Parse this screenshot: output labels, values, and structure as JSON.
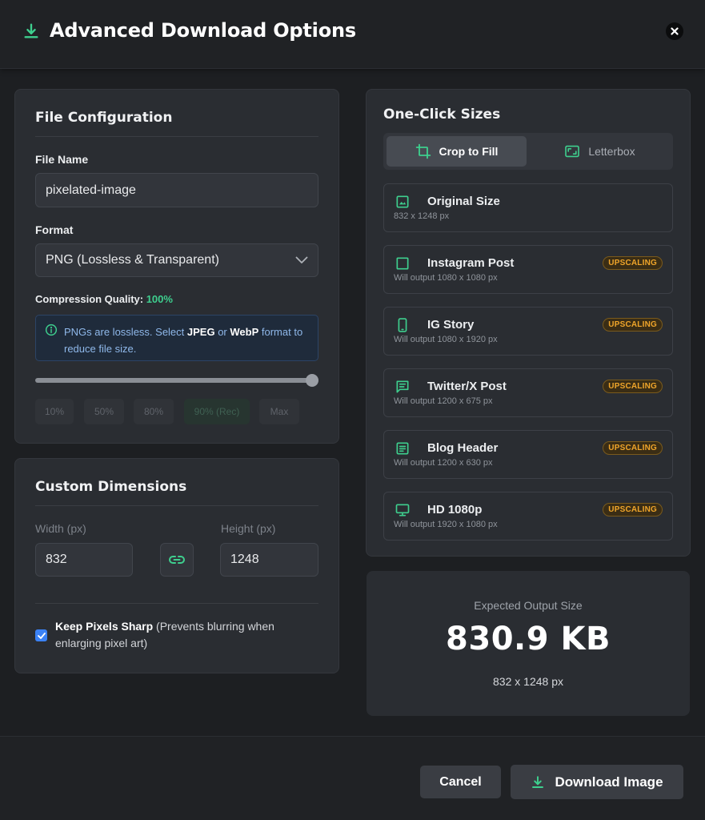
{
  "header": {
    "title": "Advanced Download Options"
  },
  "file_config": {
    "title": "File Configuration",
    "file_name_label": "File Name",
    "file_name_value": "pixelated-image",
    "format_label": "Format",
    "format_value": "PNG (Lossless & Transparent)",
    "quality_label": "Compression Quality:",
    "quality_value": "100%",
    "quality_level": 1.0,
    "info": {
      "pre": "PNGs are lossless. Select ",
      "jpeg": "JPEG",
      "mid": " or ",
      "webp": "WebP",
      "post": " format to reduce file size."
    },
    "presets": [
      "10%",
      "50%",
      "80%",
      "90% (Rec)",
      "Max"
    ]
  },
  "custom_dims": {
    "title": "Custom Dimensions",
    "width_label": "Width (px)",
    "width_value": "832",
    "height_label": "Height (px)",
    "height_value": "1248",
    "keep_sharp_bold": "Keep Pixels Sharp",
    "keep_sharp_rest": " (Prevents blurring when enlarging pixel art)",
    "keep_sharp_checked": true
  },
  "one_click": {
    "title": "One-Click Sizes",
    "toggle": [
      "Crop to Fill",
      "Letterbox"
    ],
    "items": [
      {
        "name": "Original Size",
        "sub": "832 x 1248 px",
        "badge": "",
        "icon": "image-icon"
      },
      {
        "name": "Instagram Post",
        "sub": "Will output 1080 x 1080 px",
        "badge": "UPSCALING",
        "icon": "square-icon"
      },
      {
        "name": "IG Story",
        "sub": "Will output 1080 x 1920 px",
        "badge": "UPSCALING",
        "icon": "phone-icon"
      },
      {
        "name": "Twitter/X Post",
        "sub": "Will output 1200 x 675 px",
        "badge": "UPSCALING",
        "icon": "message-icon"
      },
      {
        "name": "Blog Header",
        "sub": "Will output 1200 x 630 px",
        "badge": "UPSCALING",
        "icon": "article-icon"
      },
      {
        "name": "HD 1080p",
        "sub": "Will output 1920 x 1080 px",
        "badge": "UPSCALING",
        "icon": "monitor-icon"
      }
    ]
  },
  "output": {
    "caption": "Expected Output Size",
    "size": "830.9 KB",
    "dims": "832 x 1248 px"
  },
  "footer": {
    "cancel": "Cancel",
    "download": "Download Image"
  },
  "colors": {
    "accent": "#3ecf8e",
    "badge": "#f0a52a",
    "checkbox": "#3b82f6"
  }
}
